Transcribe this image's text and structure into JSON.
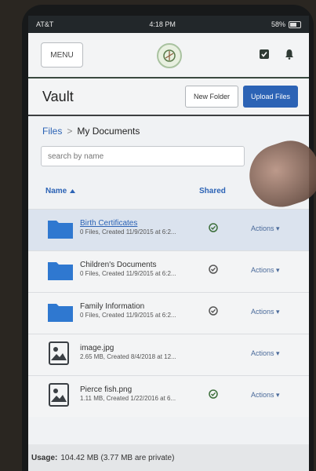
{
  "statusbar": {
    "carrier": "AT&T",
    "time": "4:18 PM",
    "battery": "58%"
  },
  "topbar": {
    "menu_label": "MENU"
  },
  "vault": {
    "title": "Vault",
    "new_folder_label": "New Folder",
    "upload_label": "Upload Files"
  },
  "breadcrumb": {
    "root": "Files",
    "separator": ">",
    "current": "My Documents"
  },
  "search": {
    "placeholder": "search by name"
  },
  "columns": {
    "name": "Name",
    "shared": "Shared"
  },
  "files": [
    {
      "name": "Birth Certificates",
      "meta": "0 Files, Created 11/9/2015 at 6:2...",
      "type": "folder",
      "shared": true,
      "actions": "Actions"
    },
    {
      "name": "Children's Documents",
      "meta": "0 Files, Created 11/9/2015 at 6:2...",
      "type": "folder",
      "shared": false,
      "actions": "Actions"
    },
    {
      "name": "Family Information",
      "meta": "0 Files, Created 11/9/2015 at 6:2...",
      "type": "folder",
      "shared": false,
      "actions": "Actions"
    },
    {
      "name": "image.jpg",
      "meta": "2.65 MB, Created 8/4/2018 at 12...",
      "type": "image",
      "shared": false,
      "actions": "Actions"
    },
    {
      "name": "Pierce fish.png",
      "meta": "1.11 MB, Created 1/22/2016 at 6...",
      "type": "image",
      "shared": true,
      "actions": "Actions"
    }
  ],
  "usage": {
    "label": "Usage:",
    "value": "104.42 MB (3.77 MB are private)"
  },
  "colors": {
    "accent": "#2c63b5",
    "folder": "#2f78d0",
    "check": "#3c6e3a"
  }
}
